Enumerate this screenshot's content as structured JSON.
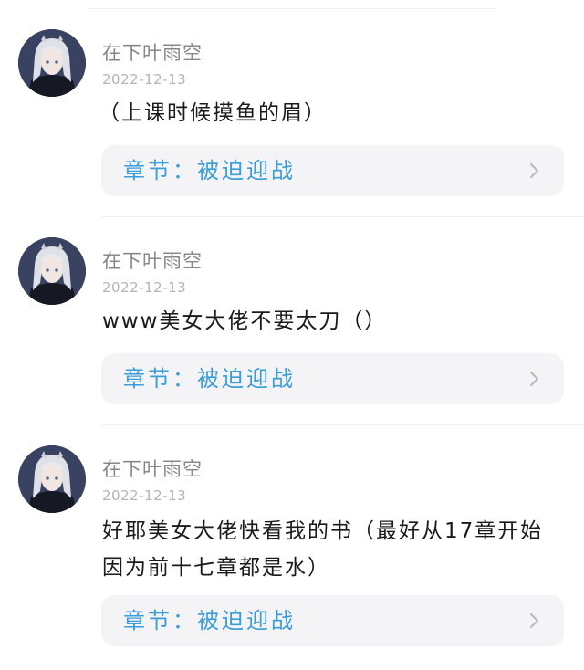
{
  "comments": [
    {
      "username": "在下叶雨空",
      "date": "2022-12-13",
      "text": "（上课时候摸鱼的眉）",
      "chapter": "章节：被迫迎战"
    },
    {
      "username": "在下叶雨空",
      "date": "2022-12-13",
      "text": "www美女大佬不要太刀（）",
      "chapter": "章节：被迫迎战"
    },
    {
      "username": "在下叶雨空",
      "date": "2022-12-13",
      "text": "好耶美女大佬快看我的书（最好从17章开始因为前十七章都是水）",
      "chapter": "章节：被迫迎战"
    }
  ],
  "colors": {
    "chapter_text": "#3b9dd8",
    "chapter_bg": "#f4f4f6",
    "username": "#888888",
    "date": "#b4b4b4"
  },
  "icons": {
    "avatar": "avatar-anime-character",
    "chevron": "chevron-right-icon"
  }
}
